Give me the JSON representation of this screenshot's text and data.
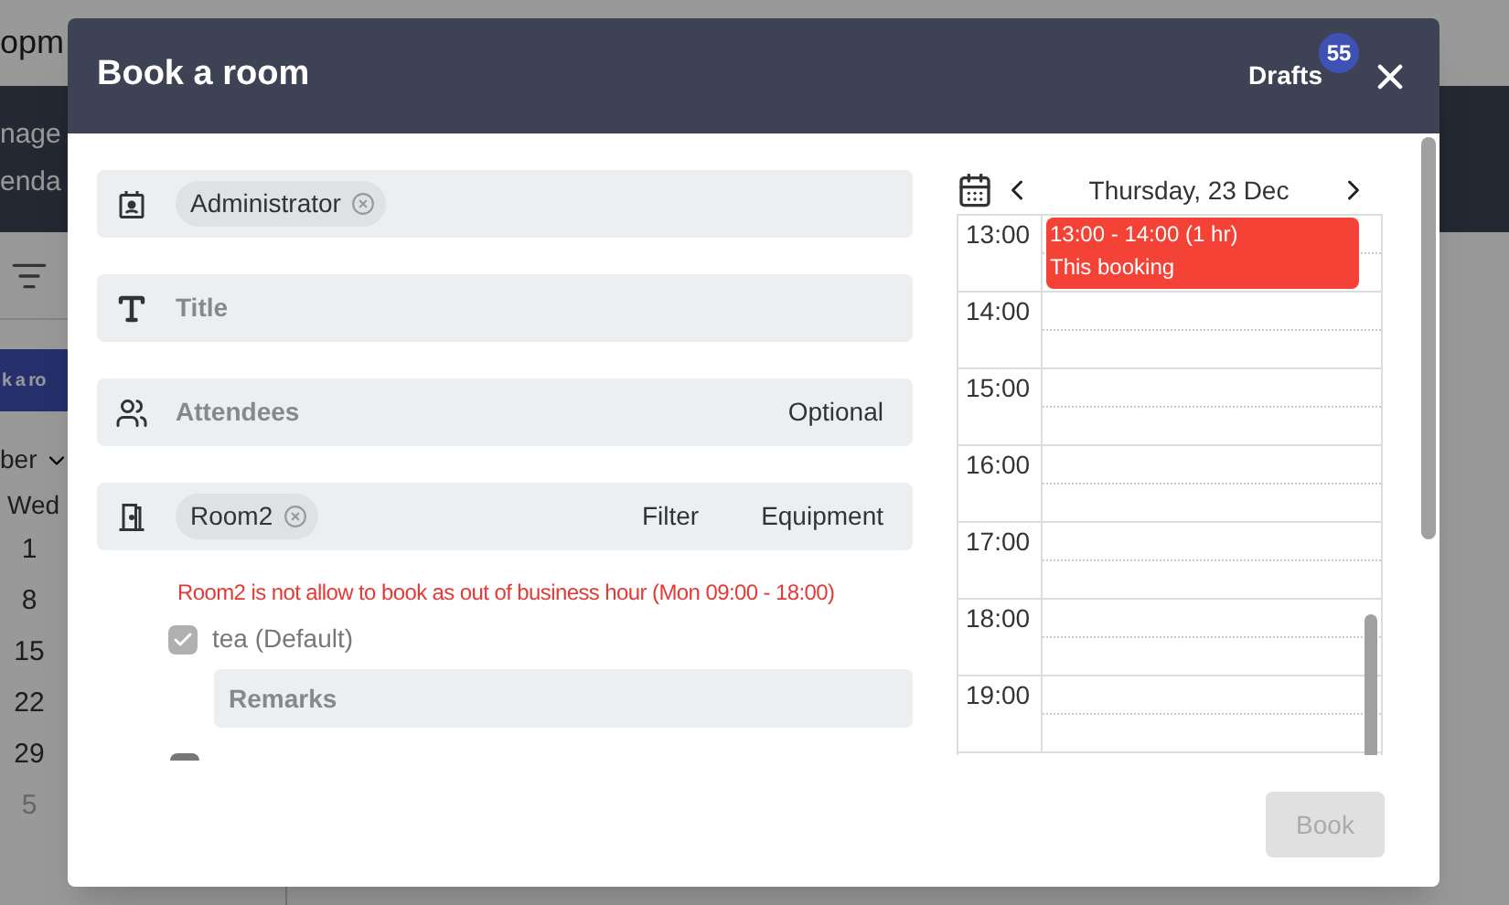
{
  "background": {
    "app_title": "opm",
    "header_lines": [
      "nage",
      "enda"
    ],
    "button": "k a ro",
    "month": "ber",
    "weekday": "Wed",
    "dates": [
      {
        "text": "1",
        "muted": false
      },
      {
        "text": "8",
        "muted": false
      },
      {
        "text": "15",
        "muted": false
      },
      {
        "text": "22",
        "muted": false
      },
      {
        "text": "29",
        "muted": false
      },
      {
        "text": "5",
        "muted": true
      }
    ]
  },
  "dialog": {
    "title": "Book a room",
    "drafts": {
      "label": "Drafts",
      "count": "55"
    },
    "fields": [
      {
        "kind": "chips",
        "chips": [
          "Administrator"
        ]
      },
      {
        "kind": "input",
        "placeholder": "Title"
      },
      {
        "kind": "input",
        "placeholder": "Attendees",
        "actions": [
          "Optional"
        ]
      },
      {
        "kind": "chips",
        "chips": [
          "Room2"
        ],
        "actions": [
          "Filter",
          "Equipment"
        ]
      }
    ],
    "error": "Room2 is not allow to book as out of business hour (Mon 09:00 - 18:00)",
    "options": [
      {
        "label": "tea (Default)",
        "checked": true,
        "remarks_placeholder": "Remarks"
      }
    ],
    "calendar": {
      "date": "Thursday, 23 Dec",
      "hours": [
        "13:00",
        "14:00",
        "15:00",
        "16:00",
        "17:00",
        "18:00",
        "19:00"
      ],
      "event": {
        "time": "13:00 - 14:00 (1 hr)",
        "label": "This booking",
        "color": "#f44336"
      }
    },
    "book_button": {
      "label": "Book",
      "disabled": true
    }
  }
}
